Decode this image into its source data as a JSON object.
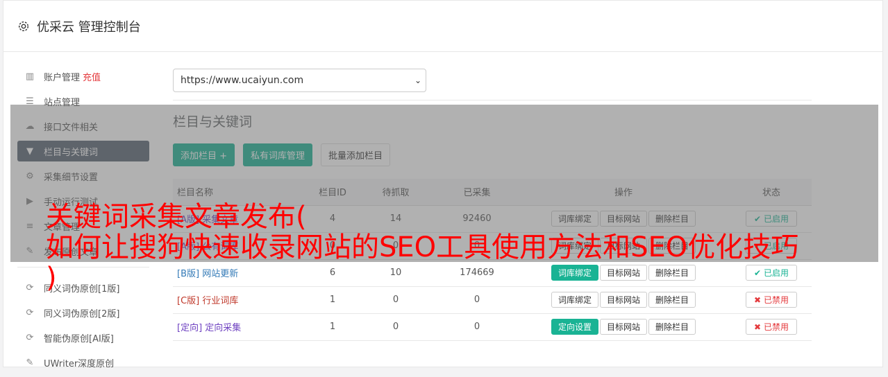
{
  "header": {
    "title": "优采云 管理控制台"
  },
  "sidebar": {
    "items": [
      {
        "label": "账户管理",
        "extra": "充值",
        "icon": "bar-chart-icon"
      },
      {
        "label": "站点管理",
        "icon": "server-icon"
      },
      {
        "label": "接口文件相关",
        "icon": "cloud-upload-icon"
      },
      {
        "label": "栏目与关键词",
        "icon": "filter-icon",
        "active": true
      },
      {
        "label": "采集细节设置",
        "icon": "gears-icon"
      },
      {
        "label": "手动运行测试",
        "icon": "play-circle-icon"
      },
      {
        "label": "文章管理",
        "icon": "database-icon"
      },
      {
        "label": "发布原创文章",
        "icon": "edit-icon"
      }
    ],
    "items2": [
      {
        "label": "同义词伪原创[1版]",
        "icon": "refresh-icon"
      },
      {
        "label": "同义词伪原创[2版]",
        "icon": "refresh-icon"
      },
      {
        "label": "智能伪原创[AI版]",
        "icon": "refresh-icon"
      },
      {
        "label": "UWriter深度原创",
        "icon": "edit-icon"
      }
    ]
  },
  "main": {
    "site_select": "https://www.ucaiyun.com",
    "section_title": "栏目与关键词",
    "buttons": {
      "add_column": "添加栏目 +",
      "private_lib": "私有词库管理",
      "batch_add": "批量添加栏目"
    },
    "table": {
      "headers": [
        "栏目名称",
        "栏目ID",
        "待抓取",
        "已采集",
        "操作",
        "状态"
      ],
      "rows": [
        {
          "tag": "[A版]",
          "name": "采集文章",
          "id": "4",
          "pending": "14",
          "collected": "92460",
          "op1": "词库绑定",
          "op2": "目标网站",
          "op3": "删除栏目",
          "status": "已启用",
          "on": true,
          "tagClass": "tag-a"
        },
        {
          "tag": "[A版]",
          "name": "公有词库",
          "id": "0",
          "pending": "0",
          "collected": "0",
          "op1": "词库绑定",
          "op2": "目标网站",
          "op3": "删除栏目",
          "status": "已启用",
          "on": true,
          "tagClass": "tag-a"
        },
        {
          "tag": "[B版]",
          "name": "网站更新",
          "id": "6",
          "pending": "10",
          "collected": "174669",
          "op1": "词库绑定",
          "op2": "目标网站",
          "op3": "删除栏目",
          "status": "已启用",
          "on": true,
          "tagClass": "tag-b"
        },
        {
          "tag": "[C版]",
          "name": "行业词库",
          "id": "1",
          "pending": "0",
          "collected": "0",
          "op1": "词库绑定",
          "op2": "目标网站",
          "op3": "删除栏目",
          "status": "已禁用",
          "on": false,
          "tagClass": "tag-c"
        },
        {
          "tag": "[定向]",
          "name": "定向采集",
          "id": "1",
          "pending": "0",
          "collected": "0",
          "op1": "定向设置",
          "op2": "目标网站",
          "op3": "删除栏目",
          "status": "已禁用",
          "on": false,
          "tagClass": "tag-d"
        }
      ]
    }
  },
  "banner": {
    "line1": "关键词采集文章发布(",
    "line2": "如何让搜狗快速收录网站的SEO工具使用方法和SEO优化技巧",
    "line3": ")"
  },
  "colors": {
    "accent": "#1ab394",
    "sidebar_active": "#586472",
    "danger": "#e4393c",
    "banner": "#ff0000"
  }
}
